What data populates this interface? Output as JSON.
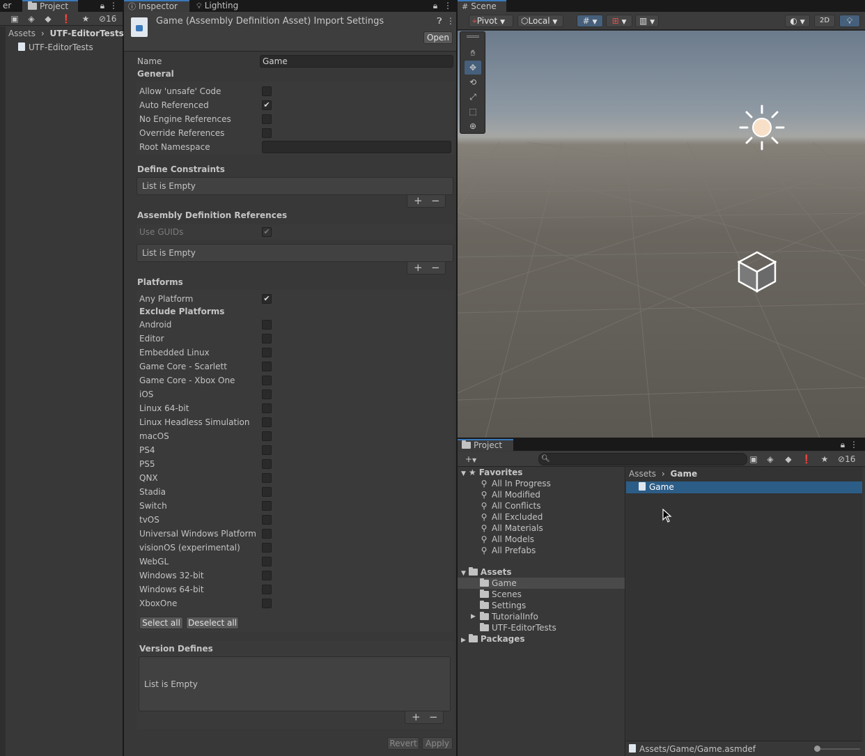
{
  "left_panel": {
    "tabs": [
      "er",
      "Project"
    ],
    "hidden_count": "16",
    "breadcrumb": {
      "root": "Assets",
      "current": "UTF-EditorTests"
    },
    "items": [
      "UTF-EditorTests"
    ]
  },
  "inspector": {
    "tabs": [
      "Inspector",
      "Lighting"
    ],
    "title": "Game (Assembly Definition Asset) Import Settings",
    "open_button": "Open",
    "name_label": "Name",
    "name_value": "Game",
    "general": {
      "header": "General",
      "rows": [
        {
          "label": "Allow 'unsafe' Code",
          "checked": false
        },
        {
          "label": "Auto Referenced",
          "checked": true
        },
        {
          "label": "No Engine References",
          "checked": false
        },
        {
          "label": "Override References",
          "checked": false
        }
      ],
      "root_namespace_label": "Root Namespace",
      "root_namespace_value": ""
    },
    "define_constraints": {
      "header": "Define Constraints",
      "empty_text": "List is Empty"
    },
    "assembly_refs": {
      "header": "Assembly Definition References",
      "use_guids_label": "Use GUIDs",
      "use_guids_checked": true,
      "empty_text": "List is Empty"
    },
    "platforms": {
      "header": "Platforms",
      "any_platform_label": "Any Platform",
      "any_platform_checked": true,
      "exclude_header": "Exclude Platforms",
      "items": [
        "Android",
        "Editor",
        "Embedded Linux",
        "Game Core - Scarlett",
        "Game Core - Xbox One",
        "iOS",
        "Linux 64-bit",
        "Linux Headless Simulation",
        "macOS",
        "PS4",
        "PS5",
        "QNX",
        "Stadia",
        "Switch",
        "tvOS",
        "Universal Windows Platform",
        "visionOS (experimental)",
        "WebGL",
        "Windows 32-bit",
        "Windows 64-bit",
        "XboxOne"
      ],
      "select_all": "Select all",
      "deselect_all": "Deselect all"
    },
    "version_defines": {
      "header": "Version Defines",
      "empty_text": "List is Empty"
    },
    "revert": "Revert",
    "apply": "Apply"
  },
  "scene": {
    "tab": "Scene",
    "pivot": "Pivot",
    "local": "Local",
    "mode_2d": "2D",
    "tools": [
      "hand-tool-icon",
      "move-tool-icon",
      "rotate-tool-icon",
      "scale-tool-icon",
      "rect-tool-icon",
      "transform-tool-icon"
    ]
  },
  "project": {
    "tab": "Project",
    "hidden_count": "16",
    "search_placeholder": "",
    "favorites_label": "Favorites",
    "favorites": [
      "All In Progress",
      "All Modified",
      "All Conflicts",
      "All Excluded",
      "All Materials",
      "All Models",
      "All Prefabs"
    ],
    "assets_label": "Assets",
    "assets": [
      "Game",
      "Scenes",
      "Settings",
      "TutorialInfo",
      "UTF-EditorTests"
    ],
    "packages_label": "Packages",
    "breadcrumb": {
      "root": "Assets",
      "current": "Game"
    },
    "files": [
      "Game"
    ],
    "status_path": "Assets/Game/Game.asmdef",
    "colors": {
      "selection": "#2c5d87",
      "highlight": "#3e5f96"
    }
  }
}
